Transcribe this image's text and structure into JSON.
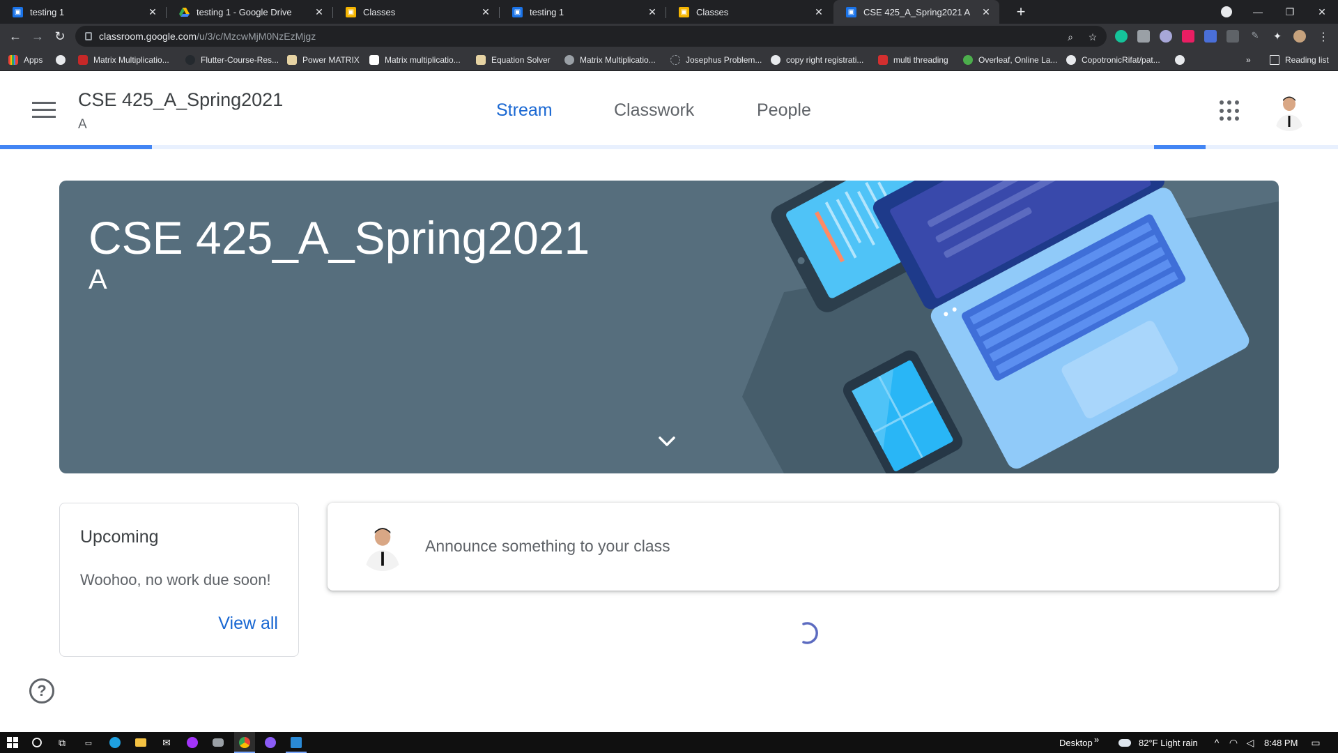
{
  "browser": {
    "tabs": [
      {
        "title": "testing 1",
        "favicon": "classroom-icon",
        "active": false
      },
      {
        "title": "testing 1 - Google Drive",
        "favicon": "drive-icon",
        "active": false
      },
      {
        "title": "Classes",
        "favicon": "classroom-yellow-icon",
        "active": false
      },
      {
        "title": "testing 1",
        "favicon": "classroom-icon",
        "active": false
      },
      {
        "title": "Classes",
        "favicon": "classroom-yellow-icon",
        "active": false
      },
      {
        "title": "CSE 425_A_Spring2021 A",
        "favicon": "classroom-icon",
        "active": true
      }
    ],
    "url_host": "classroom.google.com",
    "url_path": "/u/3/c/MzcwMjM0NzEzMjgz",
    "bookmarks": [
      {
        "label": "Apps",
        "icon": "apps-grid-icon"
      },
      {
        "label": "",
        "icon": "globe-icon"
      },
      {
        "label": "Matrix Multiplicatio...",
        "icon": "site-icon"
      },
      {
        "label": "Flutter-Course-Res...",
        "icon": "github-icon"
      },
      {
        "label": "Power MATRIX",
        "icon": "site-icon"
      },
      {
        "label": "Matrix multiplicatio...",
        "icon": "site-icon"
      },
      {
        "label": "Equation Solver",
        "icon": "site-icon"
      },
      {
        "label": "Matrix Multiplicatio...",
        "icon": "r-icon"
      },
      {
        "label": "Josephus Problem...",
        "icon": "loading-icon"
      },
      {
        "label": "copy right registrati...",
        "icon": "globe-icon"
      },
      {
        "label": "multi threading",
        "icon": "site-icon"
      },
      {
        "label": "Overleaf, Online La...",
        "icon": "overleaf-icon"
      },
      {
        "label": "CopotronicRifat/pat...",
        "icon": "github-icon"
      },
      {
        "label": "",
        "icon": "globe-icon"
      }
    ],
    "bookmarks_overflow": "»",
    "reading_list": "Reading list"
  },
  "header": {
    "class_name": "CSE 425_A_Spring2021",
    "section": "A",
    "tabs": [
      "Stream",
      "Classwork",
      "People"
    ],
    "active_tab": "Stream"
  },
  "banner": {
    "title": "CSE 425_A_Spring2021",
    "section": "A"
  },
  "upcoming": {
    "title": "Upcoming",
    "message": "Woohoo, no work due soon!",
    "view_all": "View all"
  },
  "announce": {
    "placeholder": "Announce something to your class"
  },
  "help_icon": "?",
  "taskbar": {
    "desktop_label": "Desktop",
    "chevron": "»",
    "weather": "82°F  Light rain",
    "time": "8:48 PM"
  },
  "colors": {
    "accent": "#1967d2",
    "banner": "#566e7d",
    "progress": "#4285f4"
  }
}
